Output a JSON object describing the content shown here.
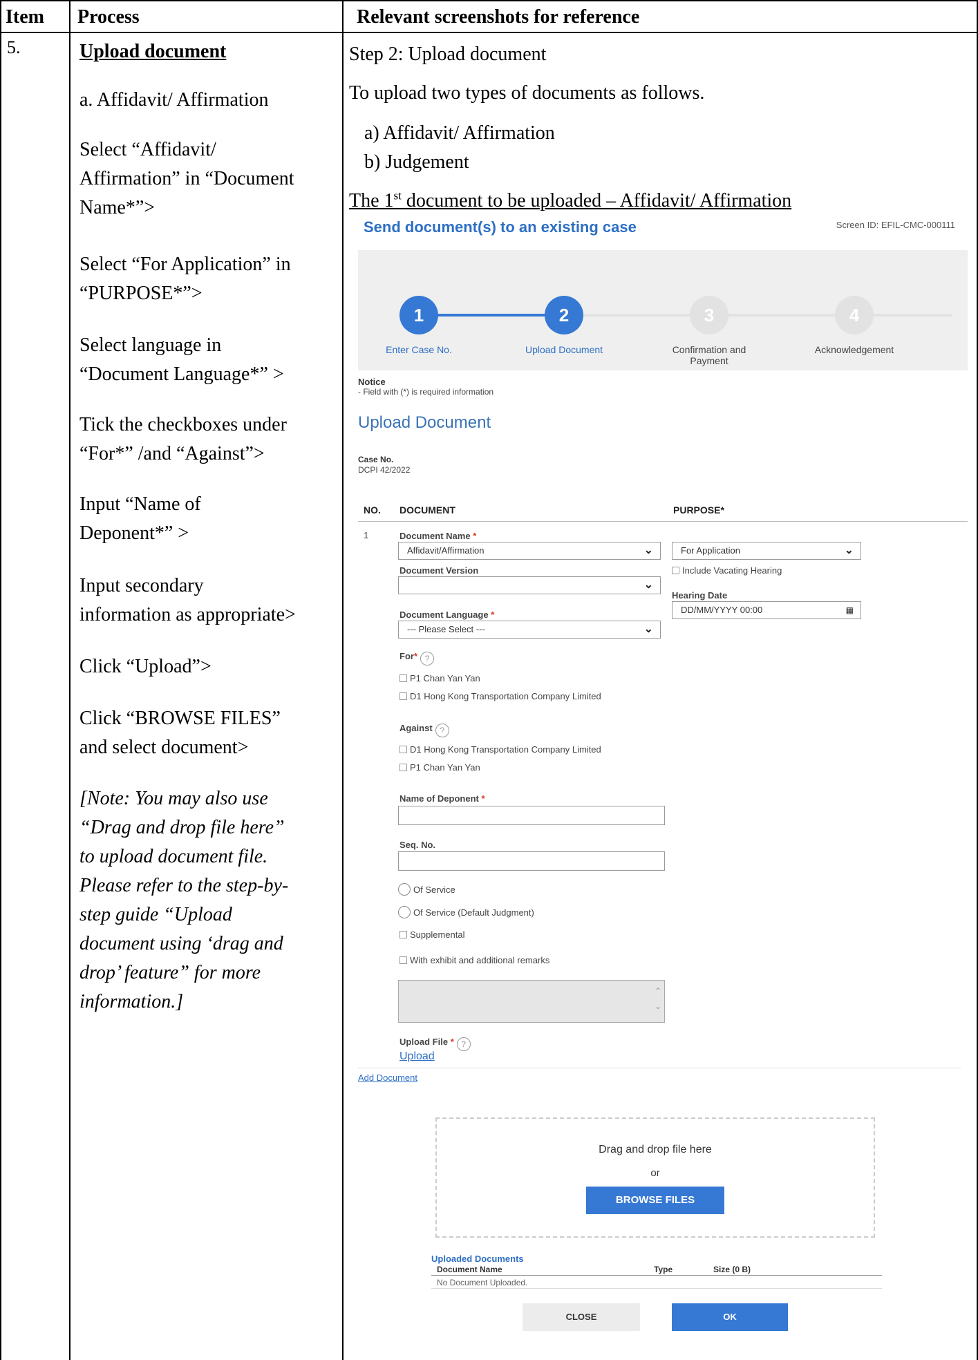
{
  "table": {
    "headers": {
      "item": "Item",
      "process": "Process",
      "screenshots": "Relevant screenshots for reference"
    },
    "item_no": "5."
  },
  "process": {
    "title": "Upload document",
    "sub": "a.  Affidavit/ Affirmation",
    "steps": [
      [
        "Select “Affidavit/",
        "Affirmation” in “Document",
        "Name*”>"
      ],
      [
        "Select “For Application” in",
        "“PURPOSE*”>"
      ],
      [
        "Select language in",
        "“Document Language*” >"
      ],
      [
        "Tick the checkboxes under",
        "“For*” /and “Against”>"
      ],
      [
        "Input “Name of",
        "Deponent*” >"
      ],
      [
        "Input secondary",
        "information as appropriate>"
      ],
      [
        "Click “Upload”>"
      ],
      [
        "Click “BROWSE FILES”",
        "and select document>"
      ]
    ],
    "note": [
      "[Note: You may also use",
      "“Drag and drop file here”",
      "to upload document file.",
      "Please refer to the step-by-",
      "step guide “Upload",
      "document using ‘drag and",
      "drop’ feature” for more",
      "information.]"
    ]
  },
  "reference": {
    "step": "Step 2: Upload document",
    "intro": "To upload two types of documents as follows.",
    "list": [
      "a)  Affidavit/ Affirmation",
      "b)  Judgement"
    ],
    "first_doc_pre": "The 1",
    "first_doc_sup": "st",
    "first_doc_post": " document to be uploaded – Affidavit/ Affirmation"
  },
  "screenshot": {
    "title": "Send document(s) to an existing case",
    "screen_id": "Screen ID: EFIL-CMC-000111",
    "steps": [
      {
        "num": "1",
        "label": "Enter Case No."
      },
      {
        "num": "2",
        "label": "Upload Document"
      },
      {
        "num": "3",
        "label": "Confirmation and Payment"
      },
      {
        "num": "4",
        "label": "Acknowledgement"
      }
    ],
    "notice_title": "Notice",
    "notice_text": "- Field with (*) is required information",
    "section_title": "Upload Document",
    "case_label": "Case No.",
    "case_value": "DCPI 42/2022",
    "col_no": "NO.",
    "col_document": "DOCUMENT",
    "col_purpose": "PURPOSE*",
    "row_no": "1",
    "doc_name_label": "Document Name",
    "doc_name_value": "Affidavit/Affirmation",
    "doc_version_label": "Document Version",
    "doc_version_value": "",
    "doc_language_label": "Document Language",
    "doc_language_value": "--- Please Select ---",
    "purpose_value": "For Application",
    "include_vacating": "Include Vacating Hearing",
    "hearing_date_label": "Hearing Date",
    "hearing_date_placeholder": "DD/MM/YYYY 00:00",
    "for_label": "For",
    "for_options": [
      "P1 Chan Yan Yan",
      "D1 Hong Kong Transportation Company Limited"
    ],
    "against_label": "Against",
    "against_options": [
      "D1 Hong Kong Transportation Company Limited",
      "P1 Chan Yan Yan"
    ],
    "deponent_label": "Name of Deponent",
    "seq_label": "Seq. No.",
    "of_service": "Of Service",
    "of_service_default": "Of Service (Default Judgment)",
    "supplemental": "Supplemental",
    "with_exhibit": "With exhibit and additional remarks",
    "upload_file_label": "Upload File",
    "upload_link": "Upload",
    "add_document": "Add Document",
    "drag_drop": "Drag and drop file here",
    "or": "or",
    "browse_files": "BROWSE FILES",
    "uploaded_title": "Uploaded Documents",
    "uploaded_col_name": "Document Name",
    "uploaded_col_type": "Type",
    "uploaded_col_size": "Size (0 B)",
    "no_document": "No Document Uploaded.",
    "close": "CLOSE",
    "ok": "OK",
    "colors": {
      "accent": "#3679d4",
      "inactive_step": "#e2e2e2"
    }
  }
}
